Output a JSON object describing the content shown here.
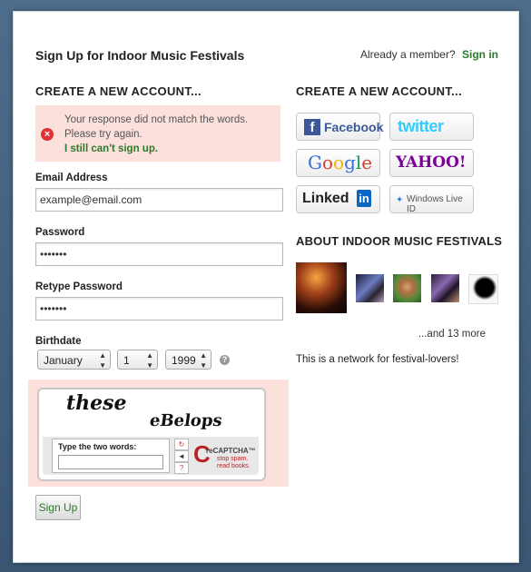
{
  "header": {
    "title": "Sign Up for Indoor Music Festivals",
    "member_prompt": "Already a member?",
    "sign_in": "Sign in"
  },
  "left": {
    "heading": "CREATE A NEW ACCOUNT...",
    "error": {
      "message": "Your response did not match the words. Please try again.",
      "link": "I still can't sign up."
    },
    "email": {
      "label": "Email Address",
      "value": "example@email.com"
    },
    "password": {
      "label": "Password",
      "value": "•••••••"
    },
    "retype": {
      "label": "Retype Password",
      "value": "•••••••"
    },
    "birthdate": {
      "label": "Birthdate",
      "month": "January",
      "day": "1",
      "year": "1999",
      "help": "?"
    },
    "captcha": {
      "word1": "these",
      "word2": "eBelops",
      "prompt": "Type the two words:",
      "brand": "reCAPTCHA™",
      "tagline": "stop spam. read books."
    },
    "submit": "Sign Up"
  },
  "right": {
    "heading": "CREATE A NEW ACCOUNT...",
    "providers": {
      "facebook": "Facebook",
      "twitter": "twitter",
      "google": "Google",
      "yahoo": "YAHOO!",
      "linkedin": "Linked",
      "linkedin_in": "in",
      "windows": "Windows Live ID"
    },
    "about_heading": "ABOUT INDOOR MUSIC FESTIVALS",
    "more": "...and 13 more",
    "description": "This is a network for festival-lovers!"
  }
}
